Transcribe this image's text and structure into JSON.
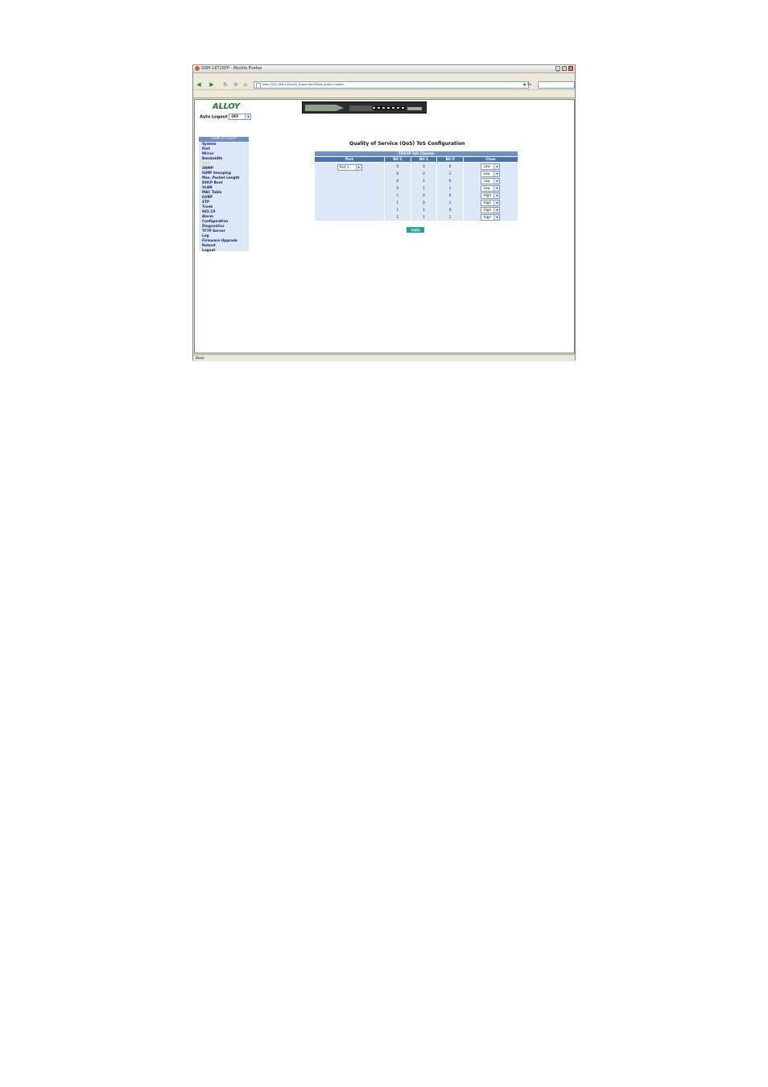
{
  "window": {
    "title": "GSM-16T2SFP - Mozilla Firefox",
    "status": "Done"
  },
  "menu": [
    "File",
    "Edit",
    "View",
    "Go",
    "Bookmarks",
    "Tools",
    "Help"
  ],
  "toolbar": {
    "url": "http://192.168.1.1/main_frame.html?host_admin=admin",
    "go_label": "Go"
  },
  "bookmarks": {
    "getting_started": "Getting Started",
    "latest_headlines": "Latest Headlines"
  },
  "app": {
    "logo_text": "ALLOY",
    "auto_logout_label": "Auto Logout",
    "auto_logout_value": "OFF"
  },
  "sidebar": {
    "header": "GSM-16T2SFP",
    "items": [
      "System",
      "Port",
      "Mirror",
      "Bandwidth",
      "QoS",
      "SNMP",
      "IGMP Snooping",
      "Max. Packet Length",
      "DHCP Boot",
      "VLAN",
      "MAC Table",
      "GVRP",
      "STP",
      "Trunk",
      "802.1X",
      "Alarm",
      "Configuration",
      "Diagnostics",
      "TFTP Server",
      "Log",
      "Firmware Upgrade",
      "Reboot",
      "Logout"
    ],
    "selected_index": 4
  },
  "page": {
    "title": "Quality of Service (QoS) ToS Configuration",
    "table_caption": "TOS/IP ToS Classes",
    "columns": [
      "Port",
      "Bit 2",
      "Bit 1",
      "Bit 0",
      "Class"
    ],
    "port_value": "Port 1",
    "rows": [
      {
        "b2": "0",
        "b1": "0",
        "b0": "0",
        "cls": "Low"
      },
      {
        "b2": "0",
        "b1": "0",
        "b0": "1",
        "cls": "Low"
      },
      {
        "b2": "0",
        "b1": "1",
        "b0": "0",
        "cls": "Low"
      },
      {
        "b2": "0",
        "b1": "1",
        "b0": "1",
        "cls": "Low"
      },
      {
        "b2": "1",
        "b1": "0",
        "b0": "0",
        "cls": "High"
      },
      {
        "b2": "1",
        "b1": "0",
        "b0": "1",
        "cls": "High"
      },
      {
        "b2": "1",
        "b1": "1",
        "b0": "0",
        "cls": "High"
      },
      {
        "b2": "1",
        "b1": "1",
        "b0": "1",
        "cls": "High"
      }
    ],
    "apply_label": "Apply"
  }
}
